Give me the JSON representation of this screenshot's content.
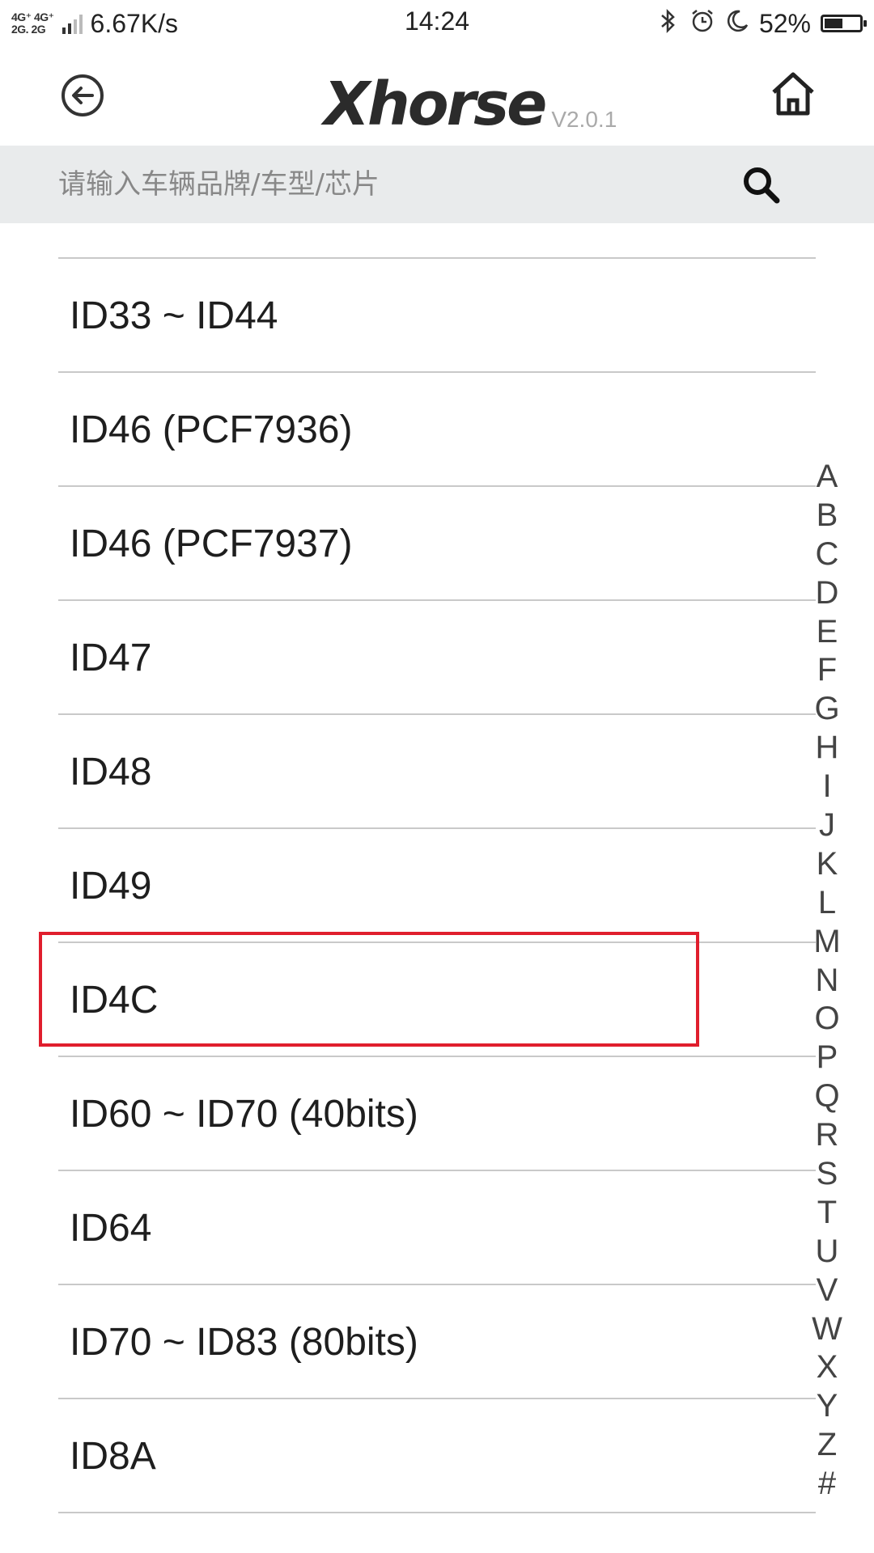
{
  "status_bar": {
    "network_types": [
      "4G⁺ 4G⁺",
      "2G. 2G"
    ],
    "data_speed": "6.67K/s",
    "time": "14:24",
    "battery_percent": "52%",
    "battery_level": 0.52,
    "icons": [
      "signal-icon",
      "bluetooth-icon",
      "alarm-icon",
      "moon-icon",
      "battery-icon"
    ]
  },
  "header": {
    "logo_text": "Xhorse",
    "version": "V2.0.1",
    "icons": [
      "back-arrow-icon",
      "home-icon"
    ]
  },
  "search": {
    "placeholder": "请输入车辆品牌/车型/芯片",
    "icon": "search-icon"
  },
  "list": {
    "items": [
      {
        "label": "ID33 ~ ID44"
      },
      {
        "label": "ID46 (PCF7936)"
      },
      {
        "label": "ID46 (PCF7937)"
      },
      {
        "label": "ID47"
      },
      {
        "label": "ID48"
      },
      {
        "label": "ID49"
      },
      {
        "label": "ID4C"
      },
      {
        "label": "ID60 ~ ID70 (40bits)"
      },
      {
        "label": "ID64"
      },
      {
        "label": "ID70 ~ ID83 (80bits)"
      },
      {
        "label": "ID8A"
      }
    ],
    "highlighted_item": "ID4C",
    "highlight_color": "#e01e2d"
  },
  "alphabet_index": [
    "A",
    "B",
    "C",
    "D",
    "E",
    "F",
    "G",
    "H",
    "I",
    "J",
    "K",
    "L",
    "M",
    "N",
    "O",
    "P",
    "Q",
    "R",
    "S",
    "T",
    "U",
    "V",
    "W",
    "X",
    "Y",
    "Z",
    "#"
  ]
}
